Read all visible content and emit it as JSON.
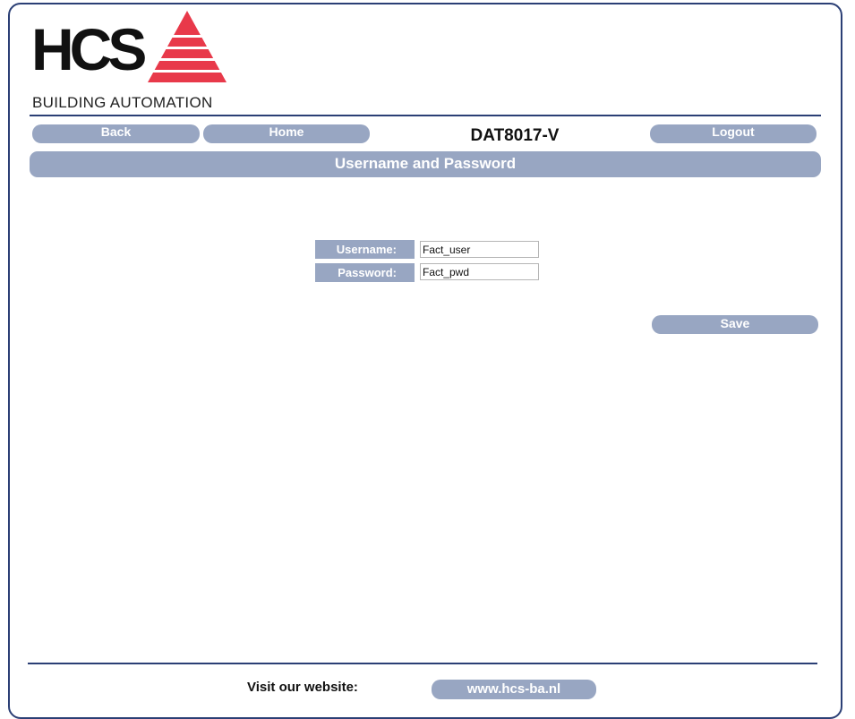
{
  "brand": {
    "logo_text": "HCS",
    "tagline": "BUILDING AUTOMATION",
    "colors": {
      "red": "#e8394a",
      "navy": "#2b3f75",
      "button": "#98a6c2"
    }
  },
  "nav": {
    "back_label": "Back",
    "home_label": "Home",
    "device_name": "DAT8017-V",
    "logout_label": "Logout"
  },
  "section": {
    "title": "Username and Password"
  },
  "form": {
    "username_label": "Username:",
    "username_value": "Fact_user",
    "password_label": "Password:",
    "password_value": "Fact_pwd",
    "save_label": "Save"
  },
  "footer": {
    "visit_label": "Visit our website:",
    "website_link": "www.hcs-ba.nl"
  }
}
